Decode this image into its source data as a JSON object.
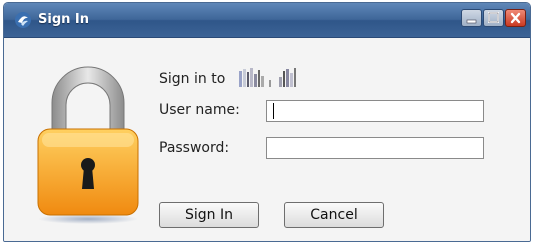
{
  "window": {
    "title": "Sign In",
    "app_icon": "lync-icon",
    "controls": [
      "minimize-icon",
      "maximize-icon",
      "close-icon"
    ]
  },
  "dialog": {
    "sign_in_to_label": "Sign in to",
    "server_name_icon": "redacted-server-name",
    "lock_icon": "padlock-icon",
    "username": {
      "label": "User name:",
      "value": "",
      "placeholder": ""
    },
    "password": {
      "label": "Password:",
      "value": "",
      "placeholder": ""
    },
    "sign_in_button": "Sign In",
    "cancel_button": "Cancel"
  },
  "colors": {
    "titlebar": "#3f6699",
    "lock_body": "#f5a623",
    "lock_shackle": "#b8b8b8",
    "close_button": "#c93a22"
  }
}
